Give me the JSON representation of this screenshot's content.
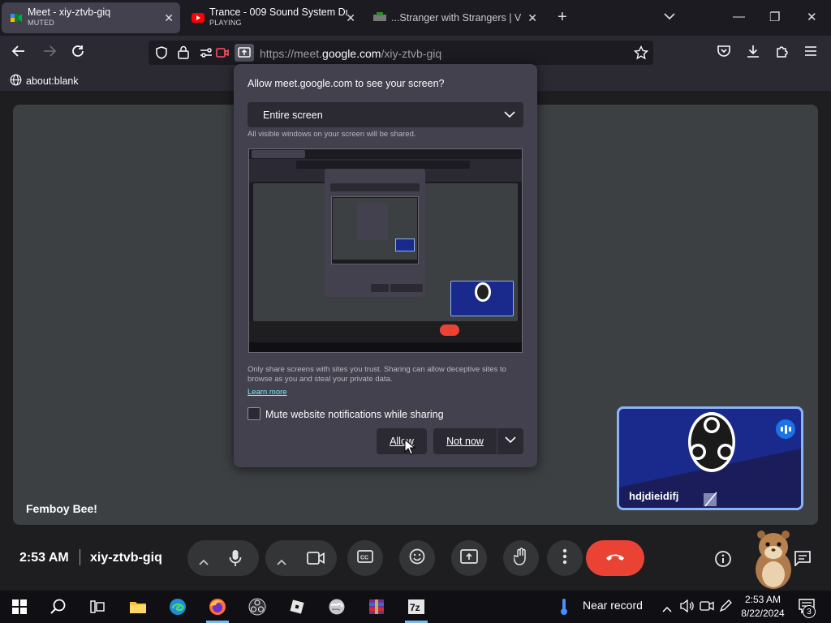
{
  "tabs": [
    {
      "title": "Meet - xiy-ztvb-giq",
      "subtitle": "MUTED",
      "favicon": "google-meet-icon",
      "active": true
    },
    {
      "title": "Trance - 009 Sound System Dr",
      "subtitle": "PLAYING",
      "favicon": "youtube-icon",
      "active": false
    },
    {
      "title": "...Stranger with Strangers | V",
      "subtitle": "",
      "favicon": "omegle-icon",
      "active": false
    }
  ],
  "url": {
    "prefix": "https://meet.",
    "domain": "google.com",
    "path": "/xiy-ztvb-giq"
  },
  "bookmarks": [
    {
      "label": "about:blank"
    }
  ],
  "dialog": {
    "title": "Allow meet.google.com to see your screen?",
    "selected_source": "Entire screen",
    "hint": "All visible windows on your screen will be shared.",
    "warning": "Only share screens with sites you trust. Sharing can allow deceptive sites to browse as you and steal your private data.",
    "learn_more": "Learn more",
    "checkbox_label": "Mute website notifications while sharing",
    "allow_label": "Allow",
    "not_now_label": "Not now"
  },
  "meet": {
    "presenter_name": "Femboy Bee!",
    "participant_name": "hdjdieidifj",
    "time": "2:53 AM",
    "meeting_code": "xiy-ztvb-giq"
  },
  "taskbar": {
    "weather": "Near record",
    "clock_time": "2:53 AM",
    "clock_date": "8/22/2024",
    "notifications": "3"
  },
  "colors": {
    "accent": "#8ab4f8",
    "end_call": "#ea4335",
    "dialog_bg": "#42414d"
  }
}
